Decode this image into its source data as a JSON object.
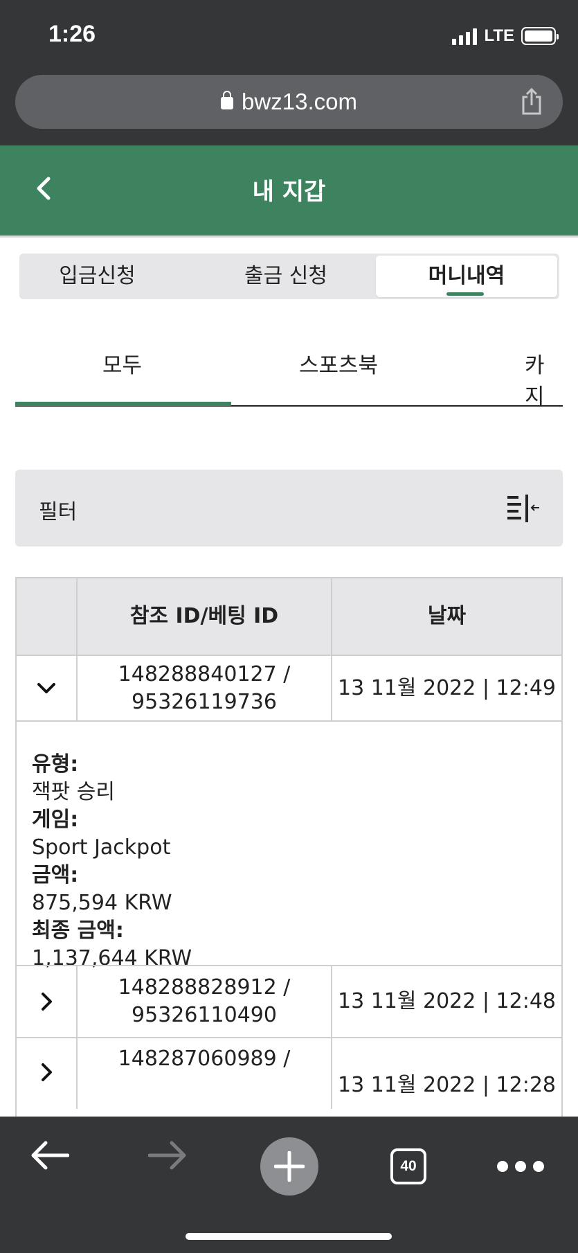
{
  "status_bar": {
    "time": "1:26",
    "network": "LTE"
  },
  "browser": {
    "url": "bwz13.com",
    "tab_count": "40"
  },
  "header": {
    "title": "내 지갑"
  },
  "segments": [
    {
      "label": "입금신청",
      "active": false
    },
    {
      "label": "출금 신청",
      "active": false
    },
    {
      "label": "머니내역",
      "active": true
    }
  ],
  "sub_tabs": [
    {
      "label": "모두",
      "active": true
    },
    {
      "label": "스포츠북",
      "active": false
    },
    {
      "label": "카지",
      "active": false
    }
  ],
  "filter": {
    "label": "필터"
  },
  "table": {
    "headers": {
      "ref": "참조 ID/베팅 ID",
      "date": "날짜"
    },
    "rows": [
      {
        "ref_line1": "148288840127 /",
        "ref_line2": "95326119736",
        "date": "13 11월 2022 | 12:49",
        "expanded": true
      },
      {
        "ref_line1": "148288828912 /",
        "ref_line2": "95326110490",
        "date": "13 11월 2022 | 12:48",
        "expanded": false
      },
      {
        "ref_line1": "148287060989 /",
        "ref_line2": "",
        "date": "13 11월 2022 | 12:28",
        "expanded": false
      }
    ],
    "detail": {
      "type_label": "유형:",
      "type_value": "잭팟 승리",
      "game_label": "게임:",
      "game_value": "Sport Jackpot",
      "amount_label": "금액:",
      "amount_value": "875,594 KRW",
      "final_label": "최종 금액:",
      "final_value": "1,137,644 KRW"
    }
  },
  "colors": {
    "brand_green": "#3d8360",
    "chrome_dark": "#353638"
  }
}
